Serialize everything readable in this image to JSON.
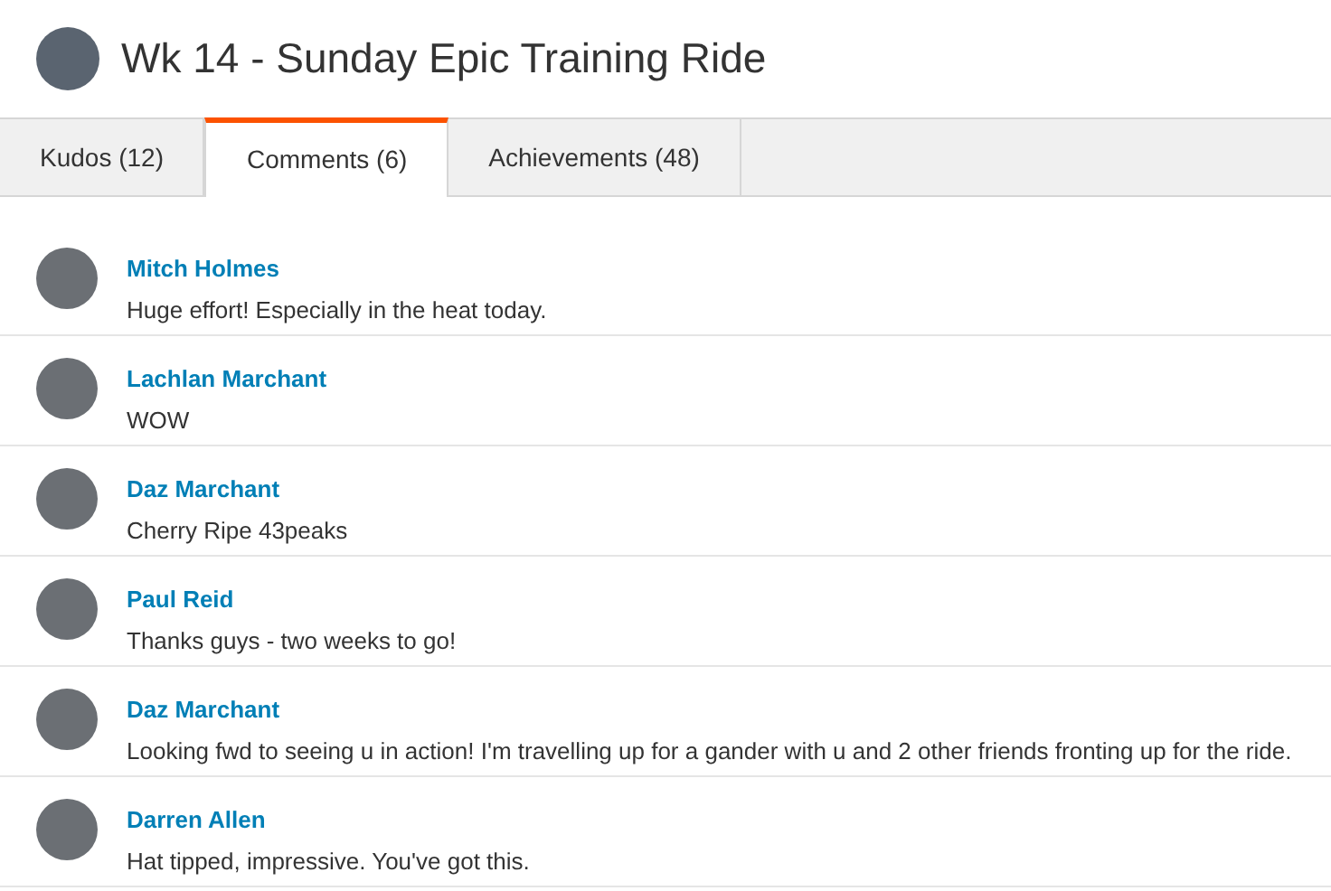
{
  "header": {
    "title": "Wk 14 - Sunday Epic Training Ride"
  },
  "tabs": [
    {
      "label": "Kudos (12)",
      "selected": false
    },
    {
      "label": "Comments (6)",
      "selected": true
    },
    {
      "label": "Achievements (48)",
      "selected": false
    }
  ],
  "comments": [
    {
      "name": "Mitch Holmes",
      "text": "Huge effort! Especially in the heat today."
    },
    {
      "name": "Lachlan Marchant",
      "text": "WOW"
    },
    {
      "name": "Daz Marchant",
      "text": "Cherry Ripe 43peaks"
    },
    {
      "name": "Paul Reid",
      "text": "Thanks guys - two weeks to go!"
    },
    {
      "name": "Daz Marchant",
      "text": "Looking fwd to seeing u in action! I'm travelling up for a gander with u and 2 other friends fronting up for the ride."
    },
    {
      "name": "Darren Allen",
      "text": "Hat tipped, impressive. You've got this."
    }
  ]
}
